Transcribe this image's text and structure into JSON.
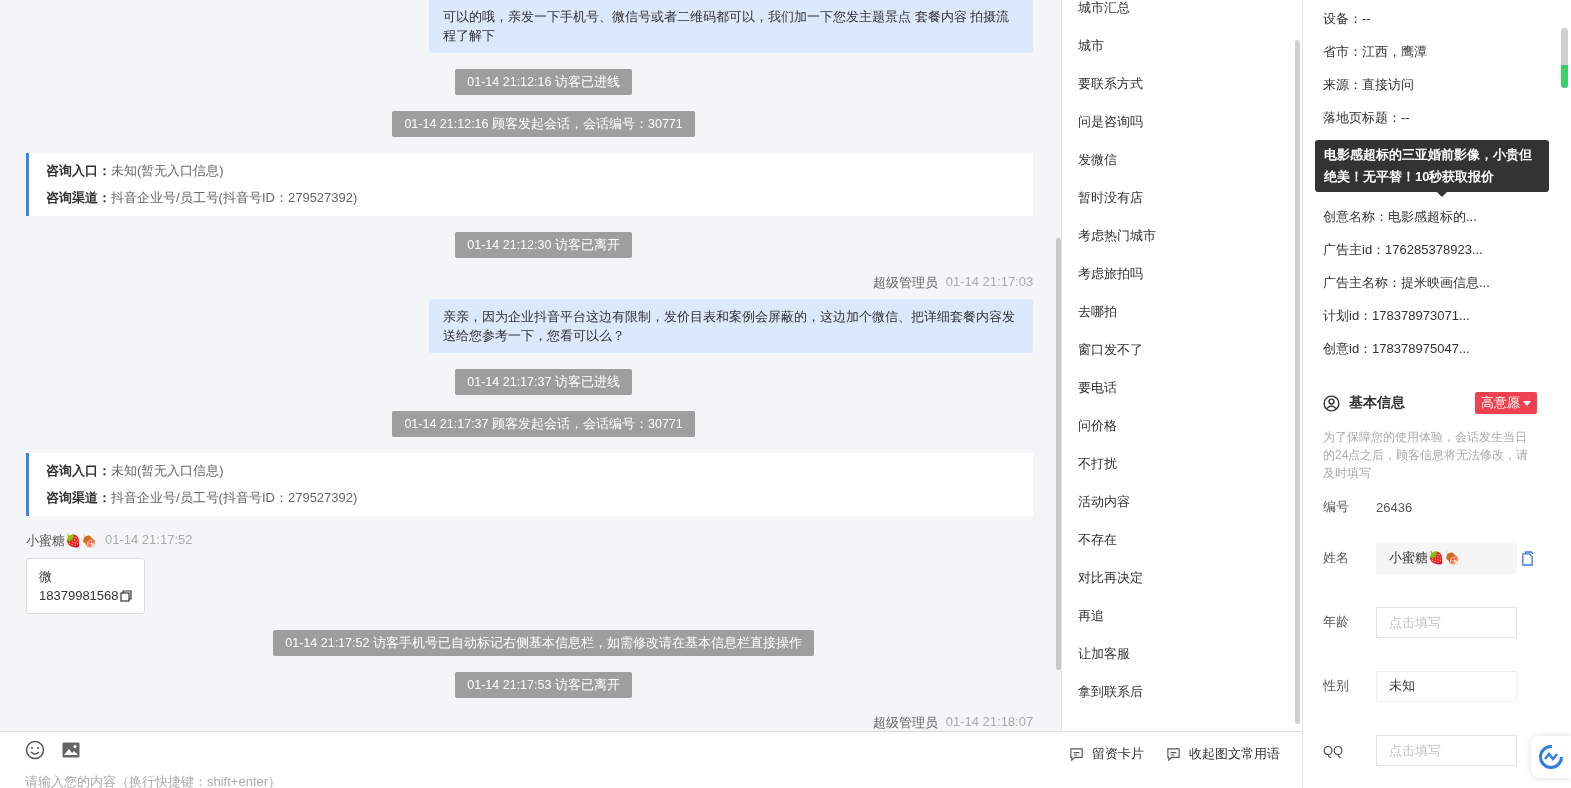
{
  "messages": [
    {
      "kind": "agent",
      "text": "可以的哦，亲发一下手机号、微信号或者二维码都可以，我们加一下您发主题景点 套餐内容 拍摄流程了解下"
    },
    {
      "kind": "system",
      "text": "01-14 21:12:16 访客已进线"
    },
    {
      "kind": "system",
      "text": "01-14 21:12:16 顾客发起会话，会话编号：30771"
    },
    {
      "kind": "source",
      "rows": [
        {
          "label": "咨询入口：",
          "value": "未知(暂无入口信息)"
        },
        {
          "label": "咨询渠道：",
          "value": "抖音企业号/员工号(抖音号ID：279527392)"
        }
      ]
    },
    {
      "kind": "system",
      "text": "01-14 21:12:30 访客已离开"
    },
    {
      "kind": "agent",
      "sender": "超级管理员",
      "time": "01-14 21:17:03",
      "text": "亲亲，因为企业抖音平台这边有限制，发价目表和案例会屏蔽的，这边加个微信、把详细套餐内容发送给您参考一下，您看可以么？"
    },
    {
      "kind": "system",
      "text": "01-14 21:17:37 访客已进线"
    },
    {
      "kind": "system",
      "text": "01-14 21:17:37 顾客发起会话，会话编号：30771"
    },
    {
      "kind": "source",
      "rows": [
        {
          "label": "咨询入口：",
          "value": "未知(暂无入口信息)"
        },
        {
          "label": "咨询渠道：",
          "value": "抖音企业号/员工号(抖音号ID：279527392)"
        }
      ]
    },
    {
      "kind": "visitor",
      "sender": "小蜜糖🍓🍖",
      "time": "01-14 21:17:52",
      "lines": [
        "微",
        "18379981568"
      ]
    },
    {
      "kind": "system",
      "text": "01-14 21:17:52 访客手机号已自动标记右侧基本信息栏，如需修改请在基本信息栏直接操作"
    },
    {
      "kind": "system",
      "text": "01-14 21:17:53 访客已离开"
    },
    {
      "kind": "agent",
      "sender": "超级管理员",
      "time": "01-14 21:18:07"
    }
  ],
  "input": {
    "placeholder": "请输入您的内容（换行快捷键：shift+enter）"
  },
  "quick_phrases": [
    "城市汇总",
    "城市",
    "要联系方式",
    "问是咨询吗",
    "发微信",
    "暂时没有店",
    "考虑热门城市",
    "考虑旅拍吗",
    "去哪拍",
    "窗口发不了",
    "要电话",
    "问价格",
    "不打扰",
    "活动内容",
    "不存在",
    "对比再决定",
    "再追",
    "让加客服",
    "拿到联系后"
  ],
  "quick_actions": [
    "留资卡片",
    "收起图文常用语"
  ],
  "visit_info": [
    "设备：--",
    "省市：江西，鹰潭",
    "来源：直接访问",
    "落地页标题：--",
    "创意名称：电影感超标的...",
    "广告主id：176285378923...",
    "广告主名称：提米映画信息...",
    "计划id：178378973071...",
    "创意id：178378975047..."
  ],
  "tooltip": "电影感超标的三亚婚前影像，小贵但绝美！无平替！10秒获取报价",
  "basic_info": {
    "title": "基本信息",
    "intent": "高意愿",
    "note": "为了保障您的使用体验，会话发生当日的24点之后，顾客信息将无法修改，请及时填写",
    "fields": [
      {
        "kind": "text",
        "label": "编号",
        "value": "26436"
      },
      {
        "kind": "copy",
        "label": "姓名",
        "value": "小蜜糖🍓🍖"
      },
      {
        "kind": "input",
        "label": "年龄",
        "placeholder": "点击填写"
      },
      {
        "kind": "select",
        "label": "性别",
        "value": "未知"
      },
      {
        "kind": "input",
        "label": "QQ",
        "placeholder": "点击填写"
      }
    ]
  }
}
